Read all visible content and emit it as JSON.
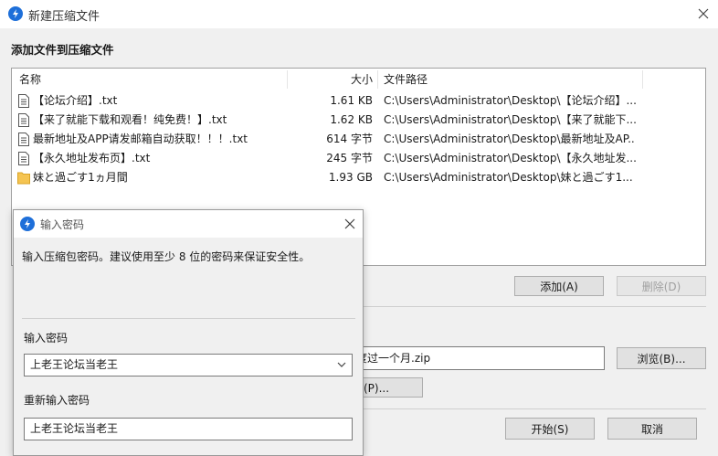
{
  "window": {
    "title": "新建压缩文件"
  },
  "main": {
    "section_title": "添加文件到压缩文件",
    "columns": {
      "name": "名称",
      "size": "大小",
      "path": "文件路径"
    },
    "files": [
      {
        "name": "【论坛介绍】.txt",
        "size": "1.61 KB",
        "path": "C:\\Users\\Administrator\\Desktop\\【论坛介绍】....",
        "icon": "text-file-icon"
      },
      {
        "name": "【来了就能下载和观看！纯免费！】.txt",
        "size": "1.62 KB",
        "path": "C:\\Users\\Administrator\\Desktop\\【来了就能下...",
        "icon": "text-file-icon"
      },
      {
        "name": "最新地址及APP请发邮箱自动获取！！！.txt",
        "size": "614 字节",
        "path": "C:\\Users\\Administrator\\Desktop\\最新地址及AP...",
        "icon": "text-file-icon"
      },
      {
        "name": "【永久地址发布页】.txt",
        "size": "245 字节",
        "path": "C:\\Users\\Administrator\\Desktop\\【永久地址发...",
        "icon": "text-file-icon"
      },
      {
        "name": "妹と過ごす1ヵ月間",
        "size": "1.93 GB",
        "path": "C:\\Users\\Administrator\\Desktop\\妹と過ごす1...",
        "icon": "folder-icon"
      }
    ],
    "add_button": "添加(A)",
    "delete_button": "删除(D)",
    "output_path_value": "度过一个月.zip",
    "browse_button": "浏览(B)...",
    "password_button": "(P)...",
    "start_button": "开始(S)",
    "cancel_button": "取消"
  },
  "dialog": {
    "title": "输入密码",
    "description": "输入压缩包密码。建议使用至少 8 位的密码来保证安全性。",
    "password_label": "输入密码",
    "password_value": "上老王论坛当老王",
    "reenter_label": "重新输入密码",
    "reenter_value": "上老王论坛当老王"
  },
  "colors": {
    "accent": "#1e6fd9",
    "folder": "#f5c451"
  }
}
